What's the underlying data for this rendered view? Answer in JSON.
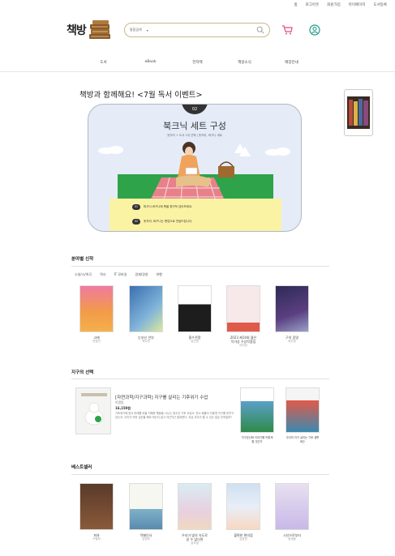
{
  "topbar": {
    "links": [
      "홈",
      "로그아웃",
      "회원가입",
      "마이페이지",
      "도서등록"
    ]
  },
  "logo": {
    "text": "책방"
  },
  "search": {
    "category": "통합검색",
    "placeholder": ""
  },
  "nav": {
    "items": [
      "도서",
      "eBook",
      "전자책",
      "책방소식",
      "매장안내"
    ]
  },
  "event": {
    "title": "책방과 함께해요! <7월 독서 이벤트>",
    "number": "02",
    "headline": "북크닉 세트 구성",
    "subline": "돗자리 + 도서 1개 선택 | 돗자리, 바구니 세트",
    "info": [
      {
        "badge": "01",
        "text": "피크닉 바구니에 책을 한가득 담아보세요."
      },
      {
        "badge": "02",
        "text": "돗자리, 바구니는 랜덤으로 전달드립니다."
      }
    ]
  },
  "new_books": {
    "title": "분야별 신작",
    "tabs": [
      "소설/시/희곡",
      "역사",
      "IT 모바일",
      "경제/경영",
      "여행"
    ],
    "items": [
      {
        "title": "고래",
        "author": "천명관"
      },
      {
        "title": "눈부신 안부",
        "author": "백수린"
      },
      {
        "title": "홍수전쟁",
        "author": "김선영"
      },
      {
        "title": "2023 제14회 젊은\n작가상 수상작품집",
        "author": "이미상"
      },
      {
        "title": "구의 증명",
        "author": "최진영"
      }
    ]
  },
  "earth_pick": {
    "title": "지구의 선택",
    "book_title": "[자연과학/지구과학] 지구를 살리는 기후위기 수업",
    "author": "이명동",
    "price": "16,150원",
    "description": "기후위기에 맞서 미래를 바꿀 지혜와 행동을 나누는 청소년 기후 교양서. 탄소 배출이 어떻게 지구를 바꾸고 있는지, 우리가 어떤 실천을 해야 하는지 쉽고 차근차근 알려준다. 지금 우리가 할 수 있는 일은 무엇일까?",
    "side_books": [
      {
        "title": "지구온난화 이야기를 어떻게 할 것인가"
      },
      {
        "title": "우리의 지구 살리는 기후 생활 레슨"
      }
    ]
  },
  "bestseller": {
    "title": "베스트셀러",
    "items": [
      {
        "title": "파과",
        "author": "구병모"
      },
      {
        "title": "작별인사",
        "author": "김영하"
      },
      {
        "title": "우리가 빛의 속도로\n갈 수 없다면",
        "author": "김초엽"
      },
      {
        "title": "불편한 편의점",
        "author": "김호연"
      },
      {
        "title": "시선으로부터",
        "author": "정세랑"
      }
    ]
  },
  "colors": {
    "accent": "#c9b98f",
    "cart": "#e74c78",
    "user": "#1a9a8a",
    "banner_bg": "#e5ecf8",
    "grass": "#2ea34a",
    "yellow": "#fbf3a4"
  }
}
